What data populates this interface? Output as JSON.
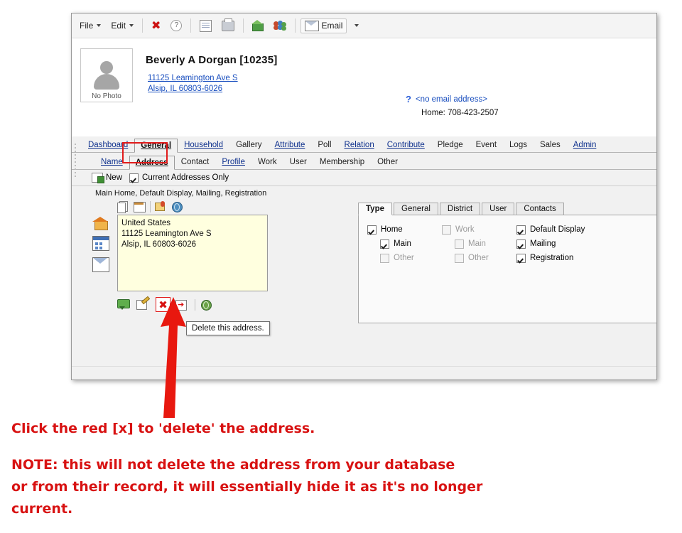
{
  "toolbar": {
    "file_label": "File",
    "edit_label": "Edit",
    "email_label": "Email",
    "icons": [
      "delete-x-icon",
      "help-icon",
      "window-icon",
      "print-icon",
      "home-icon",
      "people-icon",
      "email-icon"
    ]
  },
  "person": {
    "no_photo_label": "No Photo",
    "name": "Beverly A Dorgan  [10235]",
    "address_line1": "11125 Leamington Ave S",
    "address_line2": "Alsip, IL 60803-6026",
    "email_status": "<no email address>",
    "home_phone": "Home: 708-423-2507"
  },
  "main_tabs": [
    {
      "label": "Dashboard",
      "active": false
    },
    {
      "label": "General",
      "active": true
    },
    {
      "label": "Household",
      "active": false
    },
    {
      "label": "Gallery",
      "active": false
    },
    {
      "label": "Attribute",
      "active": false
    },
    {
      "label": "Poll",
      "active": false
    },
    {
      "label": "Relation",
      "active": false
    },
    {
      "label": "Contribute",
      "active": false
    },
    {
      "label": "Pledge",
      "active": false
    },
    {
      "label": "Event",
      "active": false
    },
    {
      "label": "Logs",
      "active": false
    },
    {
      "label": "Sales",
      "active": false
    },
    {
      "label": "Admin",
      "active": false
    }
  ],
  "sub_tabs": [
    {
      "label": "Name",
      "active": false
    },
    {
      "label": "Address",
      "active": true
    },
    {
      "label": "Contact",
      "active": false
    },
    {
      "label": "Profile",
      "active": false
    },
    {
      "label": "Work",
      "active": false
    },
    {
      "label": "User",
      "active": false
    },
    {
      "label": "Membership",
      "active": false
    },
    {
      "label": "Other",
      "active": false
    }
  ],
  "subbar": {
    "new_label": "New",
    "current_only_label": "Current Addresses Only",
    "current_only_checked": true
  },
  "address_group": {
    "group_label": "Main Home, Default Display, Mailing, Registration",
    "field_text": "United States\n11125 Leamington Ave S\nAlsip, IL  60803-6026",
    "field_lines": [
      "United States",
      "11125 Leamington Ave S",
      "Alsip, IL  60803-6026"
    ]
  },
  "right_panel": {
    "tabs": [
      {
        "label": "Type",
        "active": true
      },
      {
        "label": "General",
        "active": false
      },
      {
        "label": "District",
        "active": false
      },
      {
        "label": "User",
        "active": false
      },
      {
        "label": "Contacts",
        "active": false
      }
    ],
    "col1": [
      {
        "label": "Home",
        "checked": true,
        "enabled": true,
        "indent": false
      },
      {
        "label": "Main",
        "checked": true,
        "enabled": true,
        "indent": true
      },
      {
        "label": "Other",
        "checked": false,
        "enabled": false,
        "indent": true
      }
    ],
    "col2": [
      {
        "label": "Work",
        "checked": false,
        "enabled": false,
        "indent": false
      },
      {
        "label": "Main",
        "checked": false,
        "enabled": false,
        "indent": true
      },
      {
        "label": "Other",
        "checked": false,
        "enabled": false,
        "indent": true
      }
    ],
    "col3": [
      {
        "label": "Default Display",
        "checked": true,
        "enabled": true,
        "indent": false
      },
      {
        "label": "Mailing",
        "checked": true,
        "enabled": true,
        "indent": false
      },
      {
        "label": "Registration",
        "checked": true,
        "enabled": true,
        "indent": false
      }
    ]
  },
  "tooltip": {
    "text": "Delete this address."
  },
  "caption": {
    "line1": "Click the red [x] to 'delete' the address.",
    "note_line1": "NOTE: this will not delete the address from your database",
    "note_line2": "or from their record, it will essentially hide it as it's no longer",
    "note_line3": "current."
  },
  "colors": {
    "accent_red": "#d81212",
    "link_blue": "#1a4fbf",
    "field_yellow": "#ffffdf"
  }
}
